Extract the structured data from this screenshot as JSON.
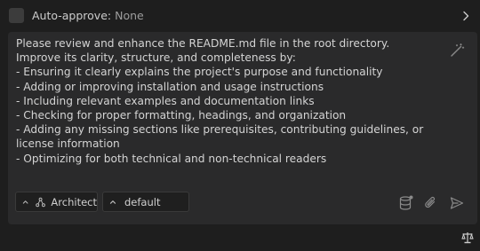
{
  "auto_approve": {
    "label": "Auto-approve:",
    "value": "None"
  },
  "message": {
    "text": "Please review and enhance the README.md file in the root directory. Improve its clarity, structure, and completeness by:\n- Ensuring it clearly explains the project's purpose and functionality\n- Adding or improving installation and usage instructions\n- Including relevant examples and documentation links\n- Checking for proper formatting, headings, and organization\n- Adding any missing sections like prerequisites, contributing guidelines, or license information\n- Optimizing for both technical and non-technical readers"
  },
  "mode_selector": {
    "label": "Architect"
  },
  "profile_selector": {
    "label": "default"
  },
  "icons": {
    "enhance": "magic-wand-icon",
    "database": "database-icon",
    "attach": "paperclip-icon",
    "send": "send-icon",
    "expand": "chevron-right-icon",
    "bottom": "scale-icon"
  },
  "colors": {
    "background": "#1e1e1e",
    "input_background": "#2a2a2b",
    "text": "#d4d4d4",
    "muted": "#9d9d9d"
  }
}
